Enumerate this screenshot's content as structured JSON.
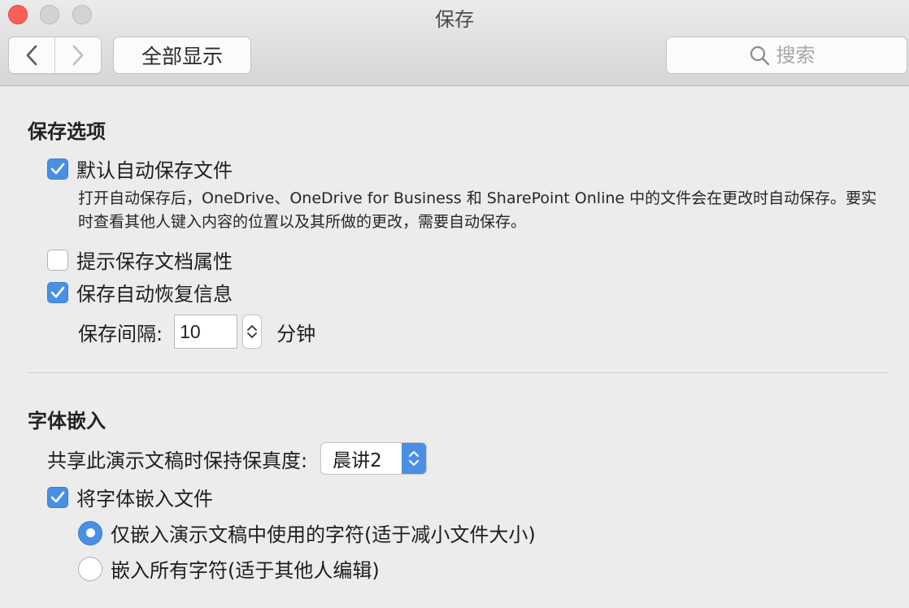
{
  "window": {
    "title": "保存"
  },
  "toolbar": {
    "back_icon": "chevron-left-icon",
    "forward_icon": "chevron-right-icon",
    "show_all_label": "全部显示",
    "search": {
      "placeholder": "搜索",
      "icon": "search-icon"
    }
  },
  "save_options": {
    "title": "保存选项",
    "autosave": {
      "label": "默认自动保存文件",
      "checked": true,
      "description": "打开自动保存后，OneDrive、OneDrive for Business 和 SharePoint Online 中的文件会在更改时自动保存。要实时查看其他人键入内容的位置以及其所做的更改，需要自动保存。"
    },
    "prompt_properties": {
      "label": "提示保存文档属性",
      "checked": false
    },
    "autorecover": {
      "label": "保存自动恢复信息",
      "checked": true
    },
    "interval": {
      "label": "保存间隔:",
      "value": "10",
      "unit": "分钟"
    }
  },
  "font_embedding": {
    "title": "字体嵌入",
    "fidelity": {
      "label": "共享此演示文稿时保持保真度:",
      "selected": "晨讲2"
    },
    "embed_fonts": {
      "label": "将字体嵌入文件",
      "checked": true
    },
    "options": [
      {
        "label": "仅嵌入演示文稿中使用的字符(适于减小文件大小)",
        "selected": true
      },
      {
        "label": "嵌入所有字符(适于其他人编辑)",
        "selected": false
      }
    ]
  },
  "colors": {
    "accent": "#4a90e2",
    "close_button": "#fc5f57"
  }
}
